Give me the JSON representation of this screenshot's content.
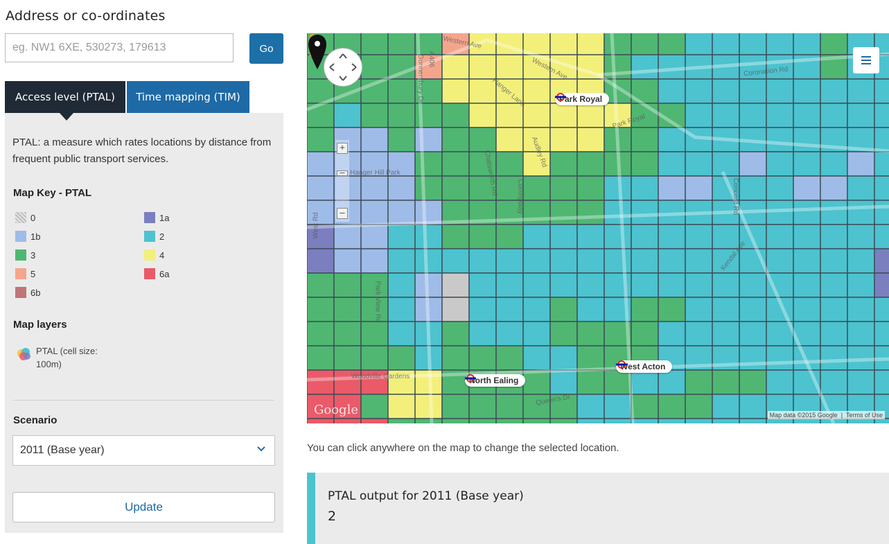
{
  "search": {
    "heading": "Address or co-ordinates",
    "placeholder": "eg. NW1 6XE, 530273, 179613",
    "value": "",
    "go_label": "Go"
  },
  "tabs": [
    {
      "label": "Access level (PTAL)",
      "active": true
    },
    {
      "label": "Time mapping (TIM)",
      "active": false
    }
  ],
  "ptal_panel": {
    "description": "PTAL: a measure which rates locations by distance from frequent public transport services.",
    "map_key_heading": "Map Key - PTAL",
    "map_key": [
      {
        "label": "0",
        "color": "hatched-grey"
      },
      {
        "label": "1a",
        "color": "#7b7fc0"
      },
      {
        "label": "1b",
        "color": "#9fbce8"
      },
      {
        "label": "2",
        "color": "#4cc3cf"
      },
      {
        "label": "3",
        "color": "#4fb772"
      },
      {
        "label": "4",
        "color": "#f2f07a"
      },
      {
        "label": "5",
        "color": "#f5a58c"
      },
      {
        "label": "6a",
        "color": "#ea5a68"
      },
      {
        "label": "6b",
        "color": "#c07578"
      }
    ],
    "layers_heading": "Map layers",
    "layers": [
      {
        "label": "PTAL (cell size: 100m)",
        "icon": "ptal-layer-icon"
      }
    ],
    "scenario_heading": "Scenario",
    "scenario_selected": "2011 (Base year)",
    "update_label": "Update"
  },
  "map": {
    "stations": [
      "Park Royal",
      "West Acton",
      "North Ealing"
    ],
    "streets": [
      "Western Ave",
      "Western Ave",
      "Park Royal",
      "Hanger Hill Park",
      "Coronation Rd",
      "Concord Rd",
      "Kendal Ave",
      "Woodville Gardens",
      "Queen's Dr",
      "Gunnersbury Dr",
      "West Rd",
      "Park View Rd",
      "A406",
      "Hanger Lane",
      "Chatsworth Rd",
      "Corringway",
      "Audley Rd"
    ],
    "attribution": "Map data ©2015 Google",
    "terms": "Terms of Use",
    "logo": "Google",
    "selected_cell_ptal": "2"
  },
  "hint": "You can click anywhere on the map to change the selected location.",
  "output": {
    "title": "PTAL output for 2011 (Base year)",
    "value": "2"
  }
}
